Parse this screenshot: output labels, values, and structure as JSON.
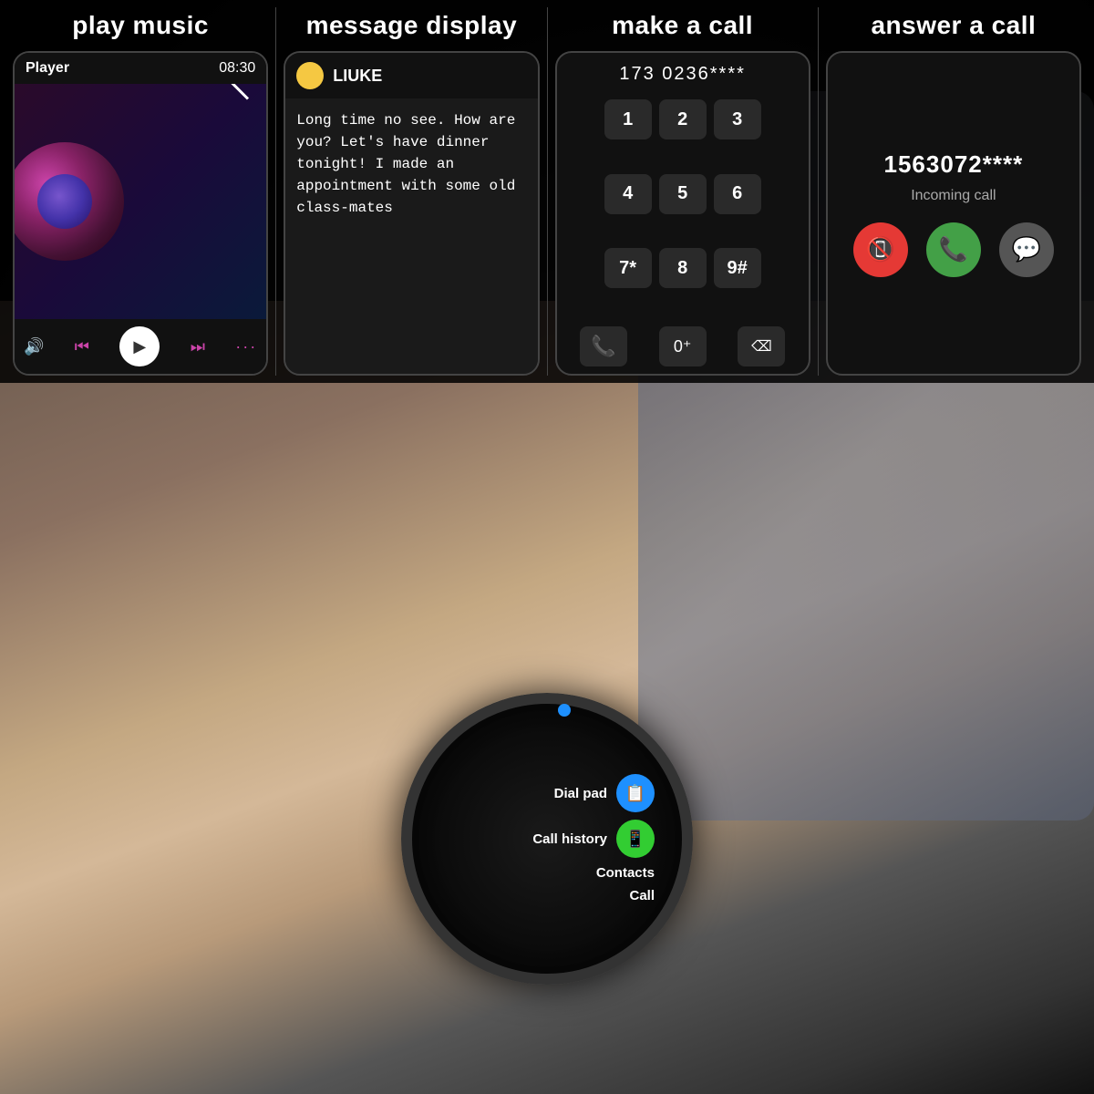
{
  "sections": {
    "play_music": {
      "label": "play music",
      "player": {
        "title": "Player",
        "time": "08:30"
      },
      "controls": {
        "volume": "🔊",
        "prev": "⏮",
        "play": "▶",
        "next": "⏭",
        "more": "···"
      }
    },
    "message_display": {
      "label": "message display",
      "sender": "LIUKE",
      "message": "Long time no see. How are you? Let's have dinner tonight! I made an appointment with some old class-mates"
    },
    "make_a_call": {
      "label": "make a call",
      "number": "173 0236****",
      "keys": [
        "1",
        "2",
        "3",
        "4",
        "5",
        "6",
        "7*",
        "8",
        "9#",
        "0+",
        "⌫"
      ]
    },
    "answer_a_call": {
      "label": "answer a call",
      "number": "1563072****",
      "incoming_label": "Incoming call"
    }
  },
  "watch": {
    "menu_items": [
      {
        "label": "Dial pad",
        "icon": "dial"
      },
      {
        "label": "Call history",
        "icon": "history"
      },
      {
        "label": "Contacts",
        "icon": "contacts"
      },
      {
        "label": "Call",
        "icon": "none"
      }
    ]
  }
}
